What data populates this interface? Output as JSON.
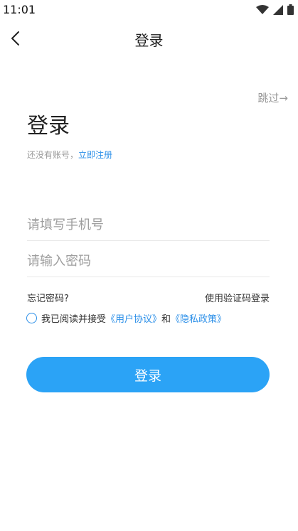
{
  "status_bar": {
    "time": "11:01"
  },
  "nav": {
    "title": "登录"
  },
  "skip": {
    "label": "跳过→"
  },
  "header": {
    "title": "登录",
    "no_account_text": "还没有账号，",
    "register_link": "立即注册"
  },
  "form": {
    "phone_placeholder": "请填写手机号",
    "password_placeholder": "请输入密码",
    "phone_value": "",
    "password_value": ""
  },
  "options": {
    "forgot_password": "忘记密码?",
    "sms_login": "使用验证码登录"
  },
  "agreement": {
    "prefix": "我已阅读并接受",
    "user_agreement": "《用户协议》",
    "conjunction": "和",
    "privacy_policy": "《隐私政策》"
  },
  "login_button": {
    "label": "登录"
  },
  "colors": {
    "accent": "#2b8fe8",
    "button": "#2ba3f6",
    "muted_text": "#9a9a9a"
  }
}
